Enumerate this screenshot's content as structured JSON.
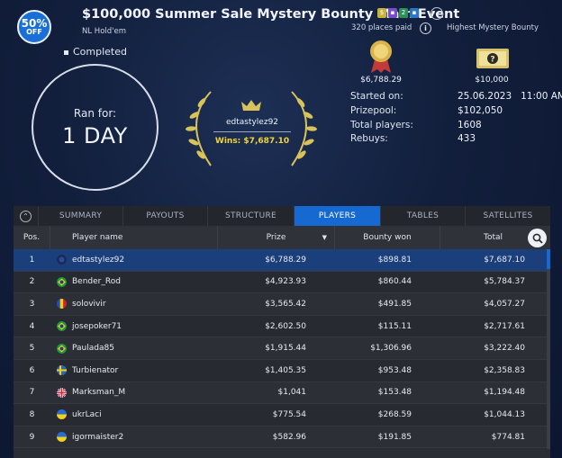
{
  "header": {
    "badge_pct": "50%",
    "badge_off": "OFF",
    "title": "$100,000 Summer Sale Mystery Bounty Main Event",
    "game": "NL Hold'em",
    "more": "···",
    "places_paid": "320 places paid",
    "info_icon": "i",
    "bounty_label": "Highest Mystery Bounty",
    "chips": [
      {
        "color": "#c7b23a",
        "glyph": "$"
      },
      {
        "color": "#7a4ccf",
        "glyph": "▪"
      },
      {
        "color": "#2d8f5a",
        "glyph": "2"
      },
      {
        "color": "#2a77c9",
        "glyph": "▪"
      }
    ]
  },
  "status": {
    "completed": "Completed",
    "ran_for_label": "Ran for:",
    "ran_for_value": "1 DAY"
  },
  "winner": {
    "name": "edtastylez92",
    "wins": "Wins: $7,687.10"
  },
  "prizes": {
    "top_prize": "$6,788.29",
    "mystery_bounty": "$10,000"
  },
  "stats": [
    {
      "label": "Started on:",
      "value": "25.06.2023   11:00 AM"
    },
    {
      "label": "Prizepool:",
      "value": "$102,050"
    },
    {
      "label": "Total players:",
      "value": "1608"
    },
    {
      "label": "Rebuys:",
      "value": "433"
    }
  ],
  "tabs": [
    "SUMMARY",
    "PAYOUTS",
    "STRUCTURE",
    "PLAYERS",
    "TABLES",
    "SATELLITES"
  ],
  "active_tab": "PLAYERS",
  "columns": {
    "pos": "Pos.",
    "name": "Player name",
    "prize": "Prize",
    "bounty": "Bounty won",
    "total": "Total"
  },
  "players": [
    {
      "pos": "1",
      "flag": "dark",
      "name": "edtastylez92",
      "prize": "$6,788.29",
      "bounty": "$898.81",
      "total": "$7,687.10"
    },
    {
      "pos": "2",
      "flag": "br",
      "name": "Bender_Rod",
      "prize": "$4,923.93",
      "bounty": "$860.44",
      "total": "$5,784.37"
    },
    {
      "pos": "3",
      "flag": "md",
      "name": "solovivir",
      "prize": "$3,565.42",
      "bounty": "$491.85",
      "total": "$4,057.27"
    },
    {
      "pos": "4",
      "flag": "br",
      "name": "josepoker71",
      "prize": "$2,602.50",
      "bounty": "$115.11",
      "total": "$2,717.61"
    },
    {
      "pos": "5",
      "flag": "br",
      "name": "Paulada85",
      "prize": "$1,915.44",
      "bounty": "$1,306.96",
      "total": "$3,222.40"
    },
    {
      "pos": "6",
      "flag": "se",
      "name": "Turbienator",
      "prize": "$1,405.35",
      "bounty": "$953.48",
      "total": "$2,358.83"
    },
    {
      "pos": "7",
      "flag": "gb",
      "name": "Marksman_M",
      "prize": "$1,041",
      "bounty": "$153.48",
      "total": "$1,194.48"
    },
    {
      "pos": "8",
      "flag": "ua",
      "name": "ukrLaci",
      "prize": "$775.54",
      "bounty": "$268.59",
      "total": "$1,044.13"
    },
    {
      "pos": "9",
      "flag": "ua",
      "name": "igormaister2",
      "prize": "$582.96",
      "bounty": "$191.85",
      "total": "$774.81"
    }
  ],
  "colors": {
    "accent": "#1669d0",
    "gold": "#f2d338"
  }
}
